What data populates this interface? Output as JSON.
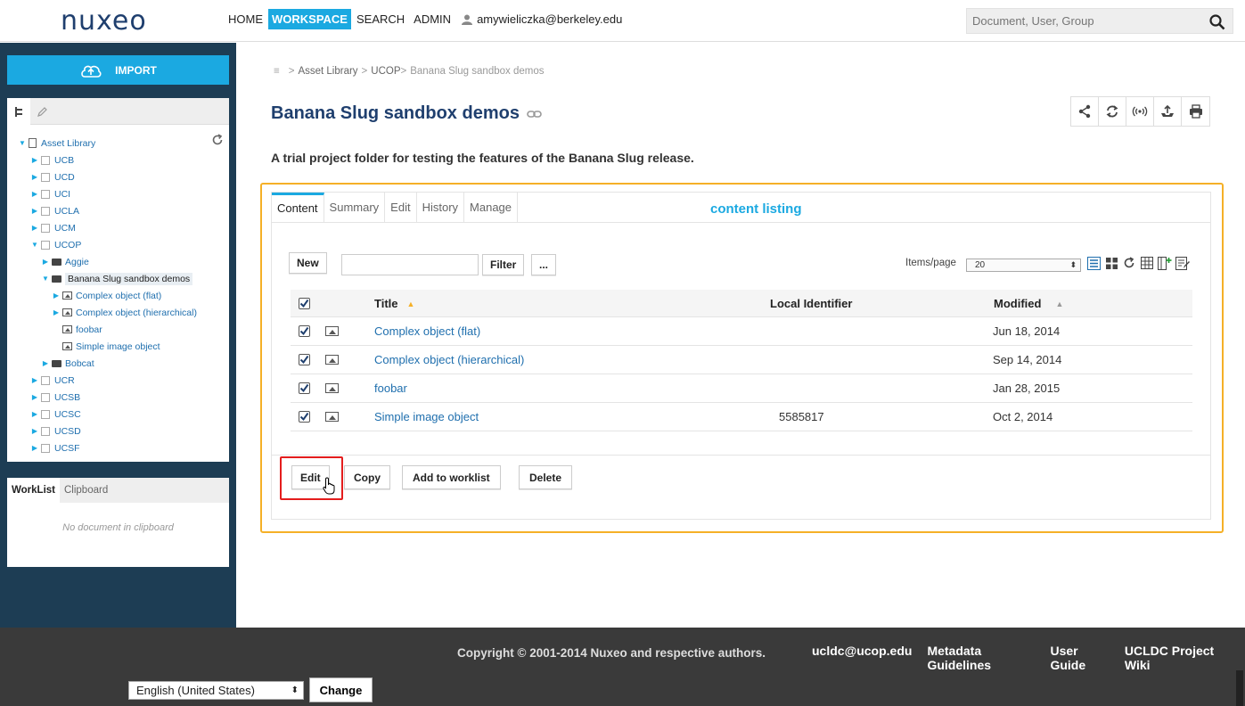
{
  "header": {
    "logo_text": "nuxeo",
    "nav": [
      "HOME",
      "WORKSPACE",
      "SEARCH",
      "ADMIN"
    ],
    "active_nav": "WORKSPACE",
    "user_email": "amywieliczka@berkeley.edu",
    "search_placeholder": "Document, User, Group"
  },
  "sidebar": {
    "import_label": "IMPORT",
    "tree": [
      {
        "label": "Asset Library",
        "level": 0,
        "expanded": true,
        "type": "root"
      },
      {
        "label": "UCB",
        "level": 1,
        "type": "collection"
      },
      {
        "label": "UCD",
        "level": 1,
        "type": "collection"
      },
      {
        "label": "UCI",
        "level": 1,
        "type": "collection"
      },
      {
        "label": "UCLA",
        "level": 1,
        "type": "collection"
      },
      {
        "label": "UCM",
        "level": 1,
        "type": "collection"
      },
      {
        "label": "UCOP",
        "level": 1,
        "expanded": true,
        "type": "collection"
      },
      {
        "label": "Aggie",
        "level": 2,
        "type": "folder"
      },
      {
        "label": "Banana Slug sandbox demos",
        "level": 2,
        "expanded": true,
        "type": "folder",
        "selected": true
      },
      {
        "label": "Complex object (flat)",
        "level": 3,
        "type": "image"
      },
      {
        "label": "Complex object (hierarchical)",
        "level": 3,
        "type": "image"
      },
      {
        "label": "foobar",
        "level": 3,
        "type": "image",
        "leaf": true
      },
      {
        "label": "Simple image object",
        "level": 3,
        "type": "image",
        "leaf": true
      },
      {
        "label": "Bobcat",
        "level": 2,
        "type": "folder"
      },
      {
        "label": "UCR",
        "level": 1,
        "type": "collection"
      },
      {
        "label": "UCSB",
        "level": 1,
        "type": "collection"
      },
      {
        "label": "UCSC",
        "level": 1,
        "type": "collection"
      },
      {
        "label": "UCSD",
        "level": 1,
        "type": "collection"
      },
      {
        "label": "UCSF",
        "level": 1,
        "type": "collection"
      }
    ],
    "worklist_tabs": [
      "WorkList",
      "Clipboard"
    ],
    "worklist_empty": "No document in clipboard"
  },
  "breadcrumb": {
    "items": [
      "Asset Library",
      "UCOP"
    ],
    "current": "Banana Slug sandbox demos"
  },
  "page": {
    "title": "Banana Slug sandbox demos",
    "description": "A trial project folder for testing the features of the Banana Slug release.",
    "action_icons": [
      "share-icon",
      "sync-icon",
      "broadcast-icon",
      "upload-icon",
      "print-icon"
    ]
  },
  "content": {
    "tabs": [
      "Content",
      "Summary",
      "Edit",
      "History",
      "Manage"
    ],
    "active_tab": "Content",
    "annotation": "content listing",
    "new_label": "New",
    "filter_value": "",
    "filter_label": "Filter",
    "more_label": "...",
    "items_per_page_label": "Items/page",
    "items_per_page_value": "20",
    "columns": [
      "Title",
      "Local Identifier",
      "Modified"
    ],
    "rows": [
      {
        "title": "Complex object (flat)",
        "local_id": "",
        "modified": "Jun 18, 2014",
        "checked": true
      },
      {
        "title": "Complex object (hierarchical)",
        "local_id": "",
        "modified": "Sep 14, 2014",
        "checked": true
      },
      {
        "title": "foobar",
        "local_id": "",
        "modified": "Jan 28, 2015",
        "checked": true
      },
      {
        "title": "Simple image object",
        "local_id": "5585817",
        "modified": "Oct 2, 2014",
        "checked": true
      }
    ],
    "bulk_actions": [
      "Edit",
      "Copy",
      "Add to worklist",
      "Delete"
    ]
  },
  "footer": {
    "copyright": "Copyright © 2001-2014 Nuxeo and respective authors.",
    "links": [
      "ucldc@ucop.edu",
      "Metadata Guidelines",
      "User Guide",
      "UCLDC Project Wiki"
    ],
    "language": "English (United States)",
    "change_label": "Change"
  },
  "colors": {
    "accent": "#1ba9e1",
    "sidebar_bg": "#1d3d54",
    "title": "#1f3f6e",
    "highlight_frame": "#f5b027",
    "edit_highlight": "#e41d1d",
    "footer_bg": "#3a3a3a"
  }
}
